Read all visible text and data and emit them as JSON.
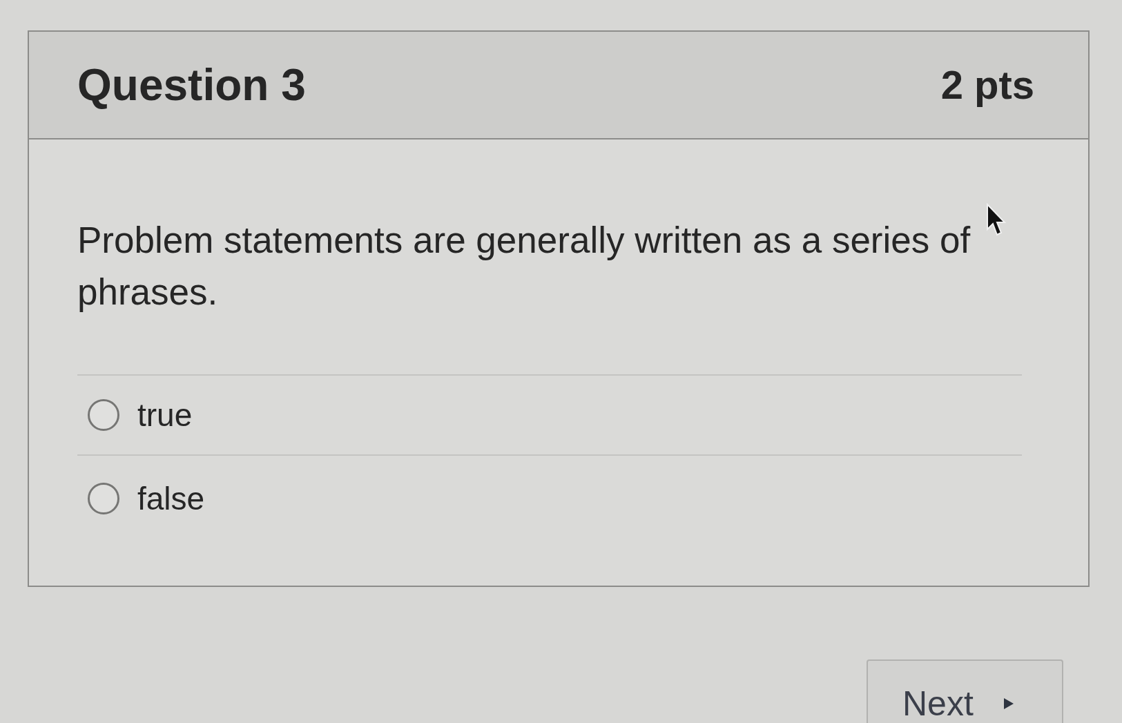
{
  "question": {
    "title": "Question 3",
    "points": "2 pts",
    "text": "Problem statements are generally written as a series of phrases."
  },
  "answers": [
    {
      "label": "true",
      "selected": false
    },
    {
      "label": "false",
      "selected": false
    }
  ],
  "next_button": {
    "label": "Next"
  }
}
